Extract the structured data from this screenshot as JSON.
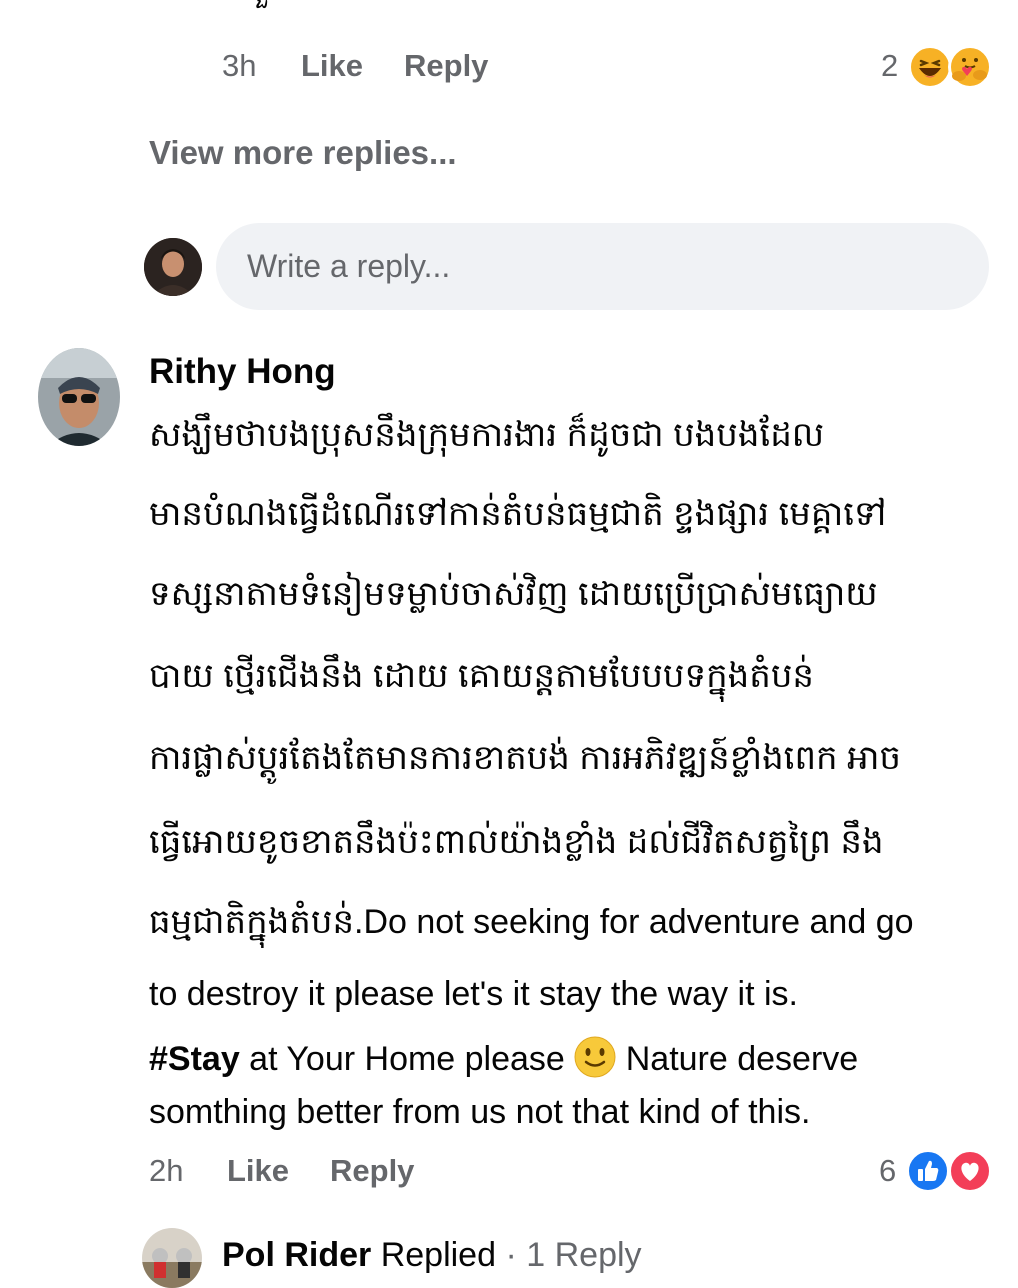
{
  "top_comment": {
    "partial_text": "ការរួចទៅ",
    "time": "3h",
    "like_label": "Like",
    "reply_label": "Reply",
    "reaction_count": "2",
    "reactions": [
      "haha-icon",
      "care-icon"
    ]
  },
  "view_more_replies": "View more replies...",
  "reply_box": {
    "placeholder": "Write a reply..."
  },
  "comment": {
    "author": "Rithy Hong",
    "lines": [
      "សង្ឃឹមថាបងប្រុសនឹងក្រុមការងារ ក៏ដូចជា បងបងដែល",
      "មានបំណងធ្វើដំណើរទៅកាន់តំបន់ធម្មជាតិ ខ្ទងផ្សារ មេគ្គាទៅ",
      "ទស្សនាតាមទំនៀមទម្លាប់ចាស់វិញ  ដោយប្រើប្រាស់មធ្យោយ",
      "បាយ ថ្មើរជើងនឹង ដោយ គោយន្តតាមបែបបទក្នុងតំបន់",
      "ការផ្លាស់ប្តូរតែងតែមានការខាតបង់ ការអភិវឌ្ឍន៍ខ្លាំងពេក អាច",
      "ធ្វើអោយខូចខាតនឹងប៉ះពាល់យ៉ាងខ្លាំង ដល់ជីវិតសត្វព្រៃ នឹង",
      "ធម្មជាតិក្នុងតំបន់.Do not seeking for adventure and go",
      "to destroy it please let's it stay the way it is."
    ],
    "hashtag": "#Stay",
    "line9_rest": " at Your Home please ",
    "line9_after": " Nature deserve",
    "line10": "somthing better from us not that kind of this.",
    "time": "2h",
    "like_label": "Like",
    "reply_label": "Reply",
    "reaction_count": "6",
    "reactions": [
      "like-icon",
      "love-icon"
    ]
  },
  "replied": {
    "author": "Pol Rider",
    "label": "Replied",
    "separator": "·",
    "count": "1 Reply"
  },
  "colors": {
    "meta_gray": "#65676b",
    "input_bg": "#f0f2f5",
    "like_blue": "#1877f2",
    "love_red": "#f33e58",
    "emoji_yellow": "#f7b125"
  }
}
